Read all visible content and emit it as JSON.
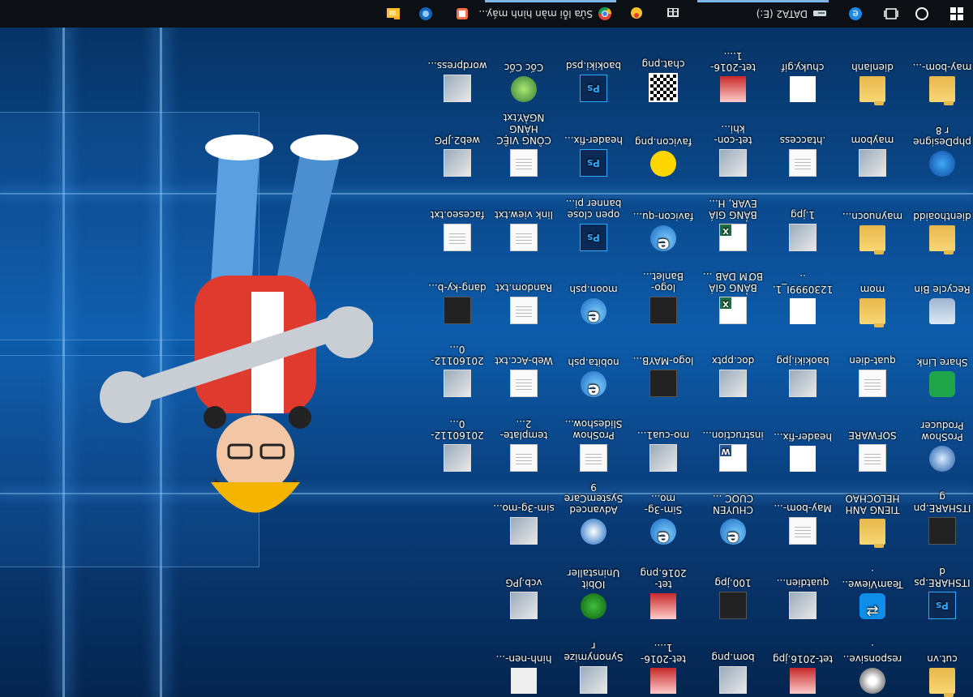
{
  "colors": {
    "taskbar": "#0c0f14",
    "accent": "#7fb6ea",
    "desktop": "#0d5cab"
  },
  "taskbar": {
    "start_icon": "windows-logo-icon",
    "search_icon": "cortana-circle-icon",
    "taskview_icon": "task-view-icon",
    "edge_icon": "edge-icon",
    "drive_label": "DATA2 (E:)",
    "drive_icon": "drive-icon",
    "store_icon": "store-icon",
    "app_icon": "chat-app-icon",
    "chrome_task_label": "Sửa lỗi màn hình máy...",
    "chrome_icon": "chrome-icon",
    "app2_icon": "app-icon",
    "app3_icon": "app-icon-2",
    "explorer_icon": "file-explorer-icon"
  },
  "desktop": {
    "columns": [
      {
        "items": [
          {
            "label": "cut.vn",
            "icon": "folder"
          },
          {
            "label": "ITSHARE.psd",
            "icon": "ps"
          },
          {
            "label": "ITSHARE.png",
            "icon": "dark"
          },
          {
            "label": "ProShow Producer",
            "icon": "proshow"
          },
          {
            "label": "Share Link",
            "icon": "green"
          },
          {
            "label": "Recycle Bin",
            "icon": "recycle"
          },
          {
            "label": "dienthoaidd",
            "icon": "folder"
          },
          {
            "label": "phpDesigner 8",
            "icon": "web"
          },
          {
            "label": "may-bom-...",
            "icon": "folder"
          }
        ]
      },
      {
        "items": [
          {
            "label": "responsive...",
            "icon": "gear"
          },
          {
            "label": "TeamViewe...",
            "icon": "teamviewer"
          },
          {
            "label": "TIENG ANH HELOCHAO",
            "icon": "folder"
          },
          {
            "label": "SOFWARE",
            "icon": "doc"
          },
          {
            "label": "quat-dien",
            "icon": "doc"
          },
          {
            "label": "mom",
            "icon": "folder"
          },
          {
            "label": "maynuocn...",
            "icon": "folder"
          },
          {
            "label": "maybom",
            "icon": "img"
          },
          {
            "label": "dienlanh",
            "icon": "folder"
          }
        ]
      },
      {
        "items": [
          {
            "label": "tet-2016.jpg",
            "icon": "thin"
          },
          {
            "label": "quatdien...",
            "icon": "img"
          },
          {
            "label": "May-bom-...",
            "icon": "doc"
          },
          {
            "label": "header-fix...",
            "icon": "line"
          },
          {
            "label": "baokiki.jpg",
            "icon": "img"
          },
          {
            "label": "1230999I_1...",
            "icon": "line"
          },
          {
            "label": "1.jpg",
            "icon": "img"
          },
          {
            "label": ".htaccess",
            "icon": "doc"
          },
          {
            "label": "chuky.gif",
            "icon": "line"
          }
        ]
      },
      {
        "items": [
          {
            "label": "bom.png",
            "icon": "img"
          },
          {
            "label": "100.jpg",
            "icon": "dark"
          },
          {
            "label": "CHUYEN CUOC ...",
            "icon": "ie"
          },
          {
            "label": "instruction...",
            "icon": "word"
          },
          {
            "label": "doc.pptx",
            "icon": "img"
          },
          {
            "label": "BẢNG GIÁ BƠM DAB ...",
            "icon": "excel"
          },
          {
            "label": "BẢNG GIÁ EVAR, H...",
            "icon": "excel"
          },
          {
            "label": "tet-con-khi...",
            "icon": "img"
          },
          {
            "label": "tet-2016-1....",
            "icon": "thin"
          }
        ]
      },
      {
        "items": [
          {
            "label": "tet-2016-1....",
            "icon": "thin"
          },
          {
            "label": "tet-2016.png",
            "icon": "thin"
          },
          {
            "label": "Sim-3g-mo...",
            "icon": "ie"
          },
          {
            "label": "mo-cua1...",
            "icon": "img"
          },
          {
            "label": "logo-MAYB...",
            "icon": "dark"
          },
          {
            "label": "logo-Banlet...",
            "icon": "dark"
          },
          {
            "label": "favicon-qu...",
            "icon": "ie"
          },
          {
            "label": "favicon.png",
            "icon": "yellow"
          },
          {
            "label": "chat.png",
            "icon": "qr"
          }
        ]
      },
      {
        "items": [
          {
            "label": "Synonymizer",
            "icon": "img"
          },
          {
            "label": "IObit Uninstaller",
            "icon": "iobit"
          },
          {
            "label": "Advanced SystemCare 9",
            "icon": "sysc"
          },
          {
            "label": "ProShow Slideshow...",
            "icon": "doc"
          },
          {
            "label": "nobita.psh",
            "icon": "ie"
          },
          {
            "label": "moon.psh",
            "icon": "ie"
          },
          {
            "label": "open close banner pi...",
            "icon": "ps"
          },
          {
            "label": "header-fix...",
            "icon": "ps"
          },
          {
            "label": "baokiki.psd",
            "icon": "ps"
          }
        ]
      },
      {
        "items": [
          {
            "label": "hinh-nen-...",
            "icon": "noimg"
          },
          {
            "label": "vcb.JPG",
            "icon": "img"
          },
          {
            "label": "sim-3g-mo...",
            "icon": "img"
          },
          {
            "label": "template-2...",
            "icon": "doc"
          },
          {
            "label": "Web-Acc.txt",
            "icon": "doc"
          },
          {
            "label": "Random.txt",
            "icon": "doc"
          },
          {
            "label": "link view.txt",
            "icon": "doc"
          },
          {
            "label": "CÔNG VIỆC HÀNG NGÀY.txt",
            "icon": "doc"
          },
          {
            "label": "Cốc Cốc",
            "icon": "coccoc"
          }
        ]
      },
      {
        "items": [
          {
            "label": "",
            "icon": "none"
          },
          {
            "label": "",
            "icon": "none"
          },
          {
            "label": "",
            "icon": "none"
          },
          {
            "label": "20160112-0...",
            "icon": "img"
          },
          {
            "label": "20160112-0...",
            "icon": "img"
          },
          {
            "label": "dang-ky-b...",
            "icon": "dark"
          },
          {
            "label": "faceseo.txt",
            "icon": "doc"
          },
          {
            "label": "web2.JPG",
            "icon": "img"
          },
          {
            "label": "wordpress...",
            "icon": "img"
          }
        ]
      }
    ]
  }
}
